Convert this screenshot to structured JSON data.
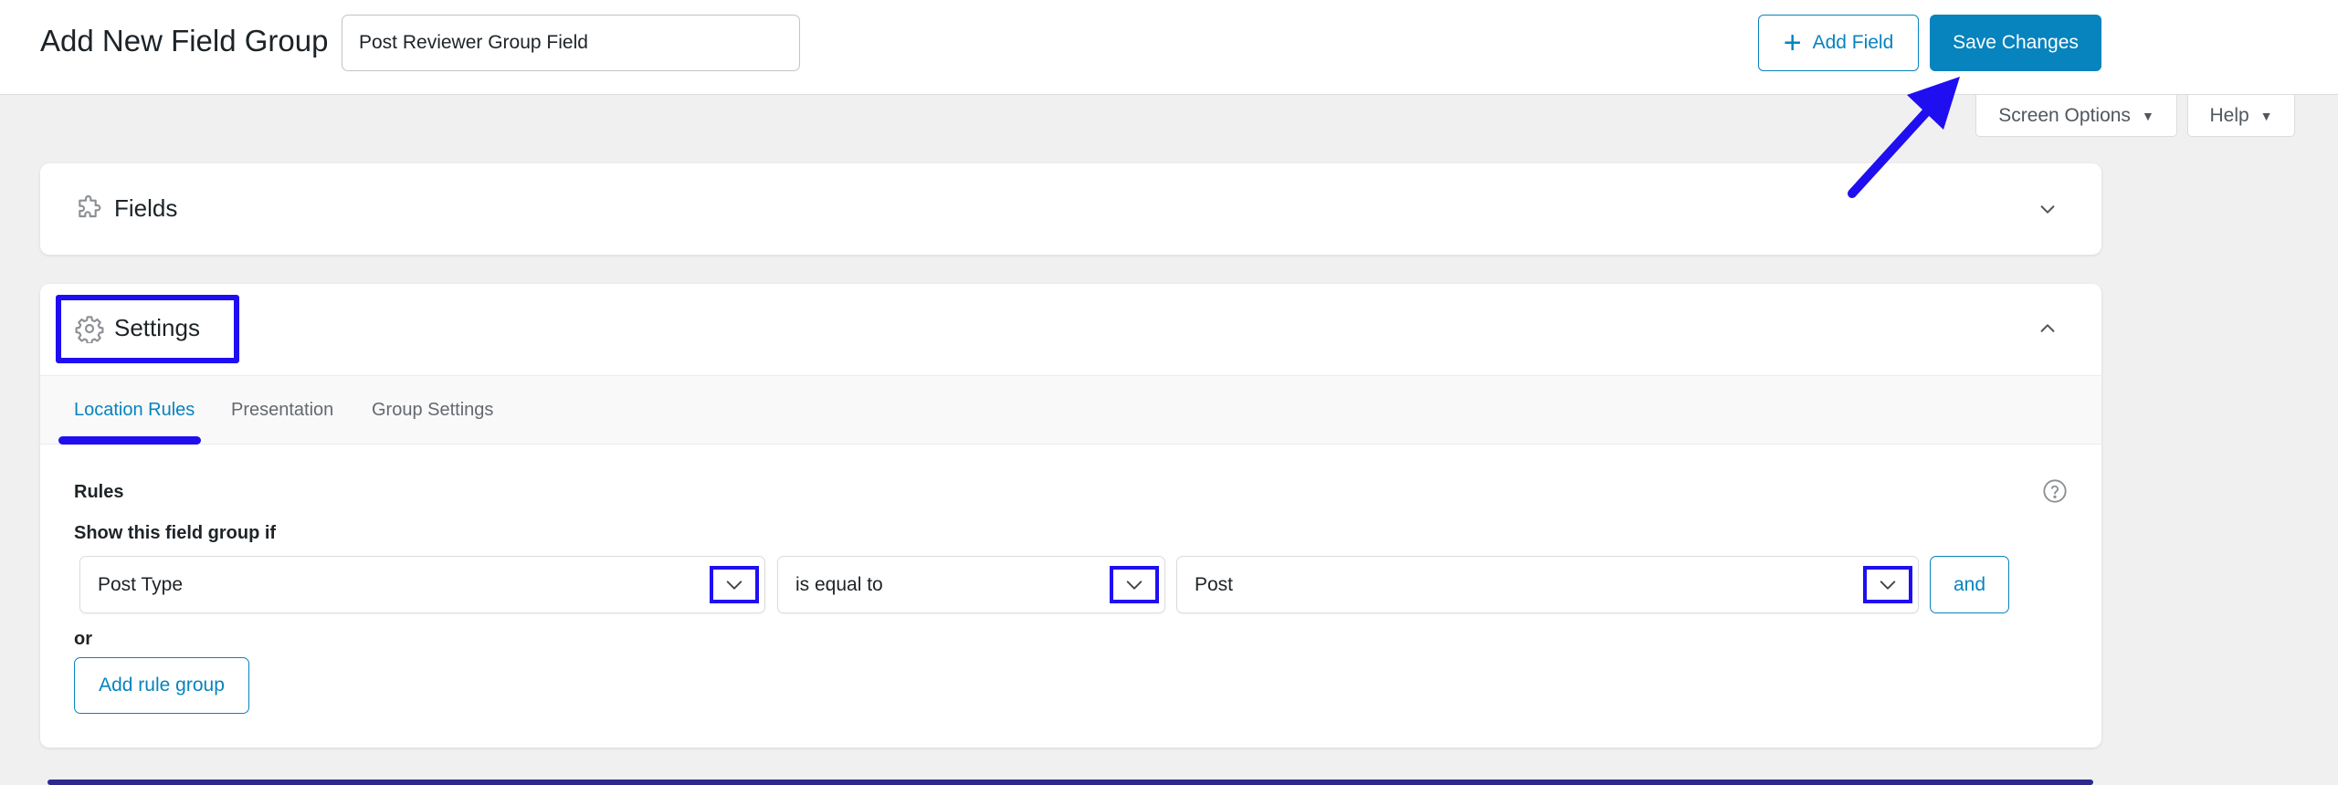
{
  "header": {
    "title": "Add New Field Group",
    "field_group_title_value": "Post Reviewer Group Field",
    "add_field_label": "Add Field",
    "save_label": "Save Changes"
  },
  "screen_meta": {
    "screen_options_label": "Screen Options",
    "help_label": "Help"
  },
  "fields_panel": {
    "title": "Fields",
    "icon": "puzzle-icon"
  },
  "settings_panel": {
    "title": "Settings",
    "icon": "gear-icon",
    "tabs": [
      {
        "label": "Location Rules",
        "active": true
      },
      {
        "label": "Presentation",
        "active": false
      },
      {
        "label": "Group Settings",
        "active": false
      }
    ],
    "rules_label": "Rules",
    "show_if_label": "Show this field group if",
    "rule": {
      "param": "Post Type",
      "operator": "is equal to",
      "value": "Post"
    },
    "and_label": "and",
    "or_label": "or",
    "add_rule_group_label": "Add rule group"
  },
  "colors": {
    "primary": "#0783be",
    "annotation": "#1f0ff0",
    "background": "#f0f0f1"
  }
}
